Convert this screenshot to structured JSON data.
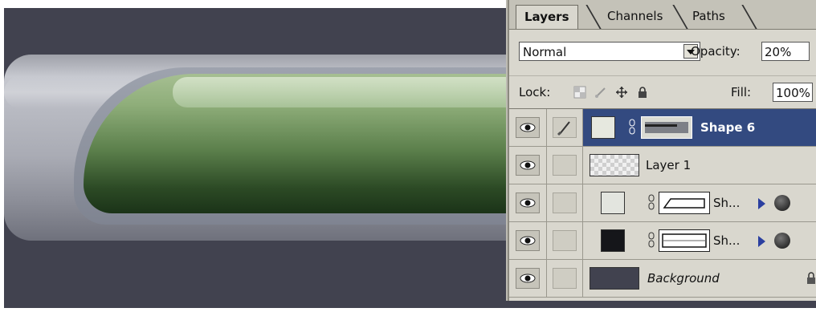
{
  "panel": {
    "tabs": [
      {
        "label": "Layers",
        "active": true
      },
      {
        "label": "Channels",
        "active": false
      },
      {
        "label": "Paths",
        "active": false
      }
    ],
    "blend_mode": "Normal",
    "opacity_label": "Opacity:",
    "opacity_value": "20%",
    "lock_label": "Lock:",
    "fill_label": "Fill:",
    "fill_value": "100%",
    "layers": [
      {
        "name": "Shape 6",
        "selected": true,
        "icons": [
          "eye-icon",
          "brush-icon",
          "chain-link-icon"
        ]
      },
      {
        "name": "Layer 1",
        "selected": false,
        "icons": [
          "eye-icon"
        ]
      },
      {
        "name": "Sh...",
        "selected": false,
        "icons": [
          "eye-icon",
          "chain-link-icon",
          "expand-triangle-icon",
          "layer-effects-icon"
        ]
      },
      {
        "name": "Sh...",
        "selected": false,
        "icons": [
          "eye-icon",
          "chain-link-icon",
          "expand-triangle-icon",
          "layer-effects-icon"
        ]
      },
      {
        "name": "Background",
        "selected": false,
        "icons": [
          "eye-icon",
          "lock-icon"
        ]
      }
    ]
  },
  "colors": {
    "selected_row": "#334a80",
    "panel_bg": "#d9d7ce",
    "canvas_bg": "#41424f",
    "green_fill": "#5b7f4b"
  }
}
